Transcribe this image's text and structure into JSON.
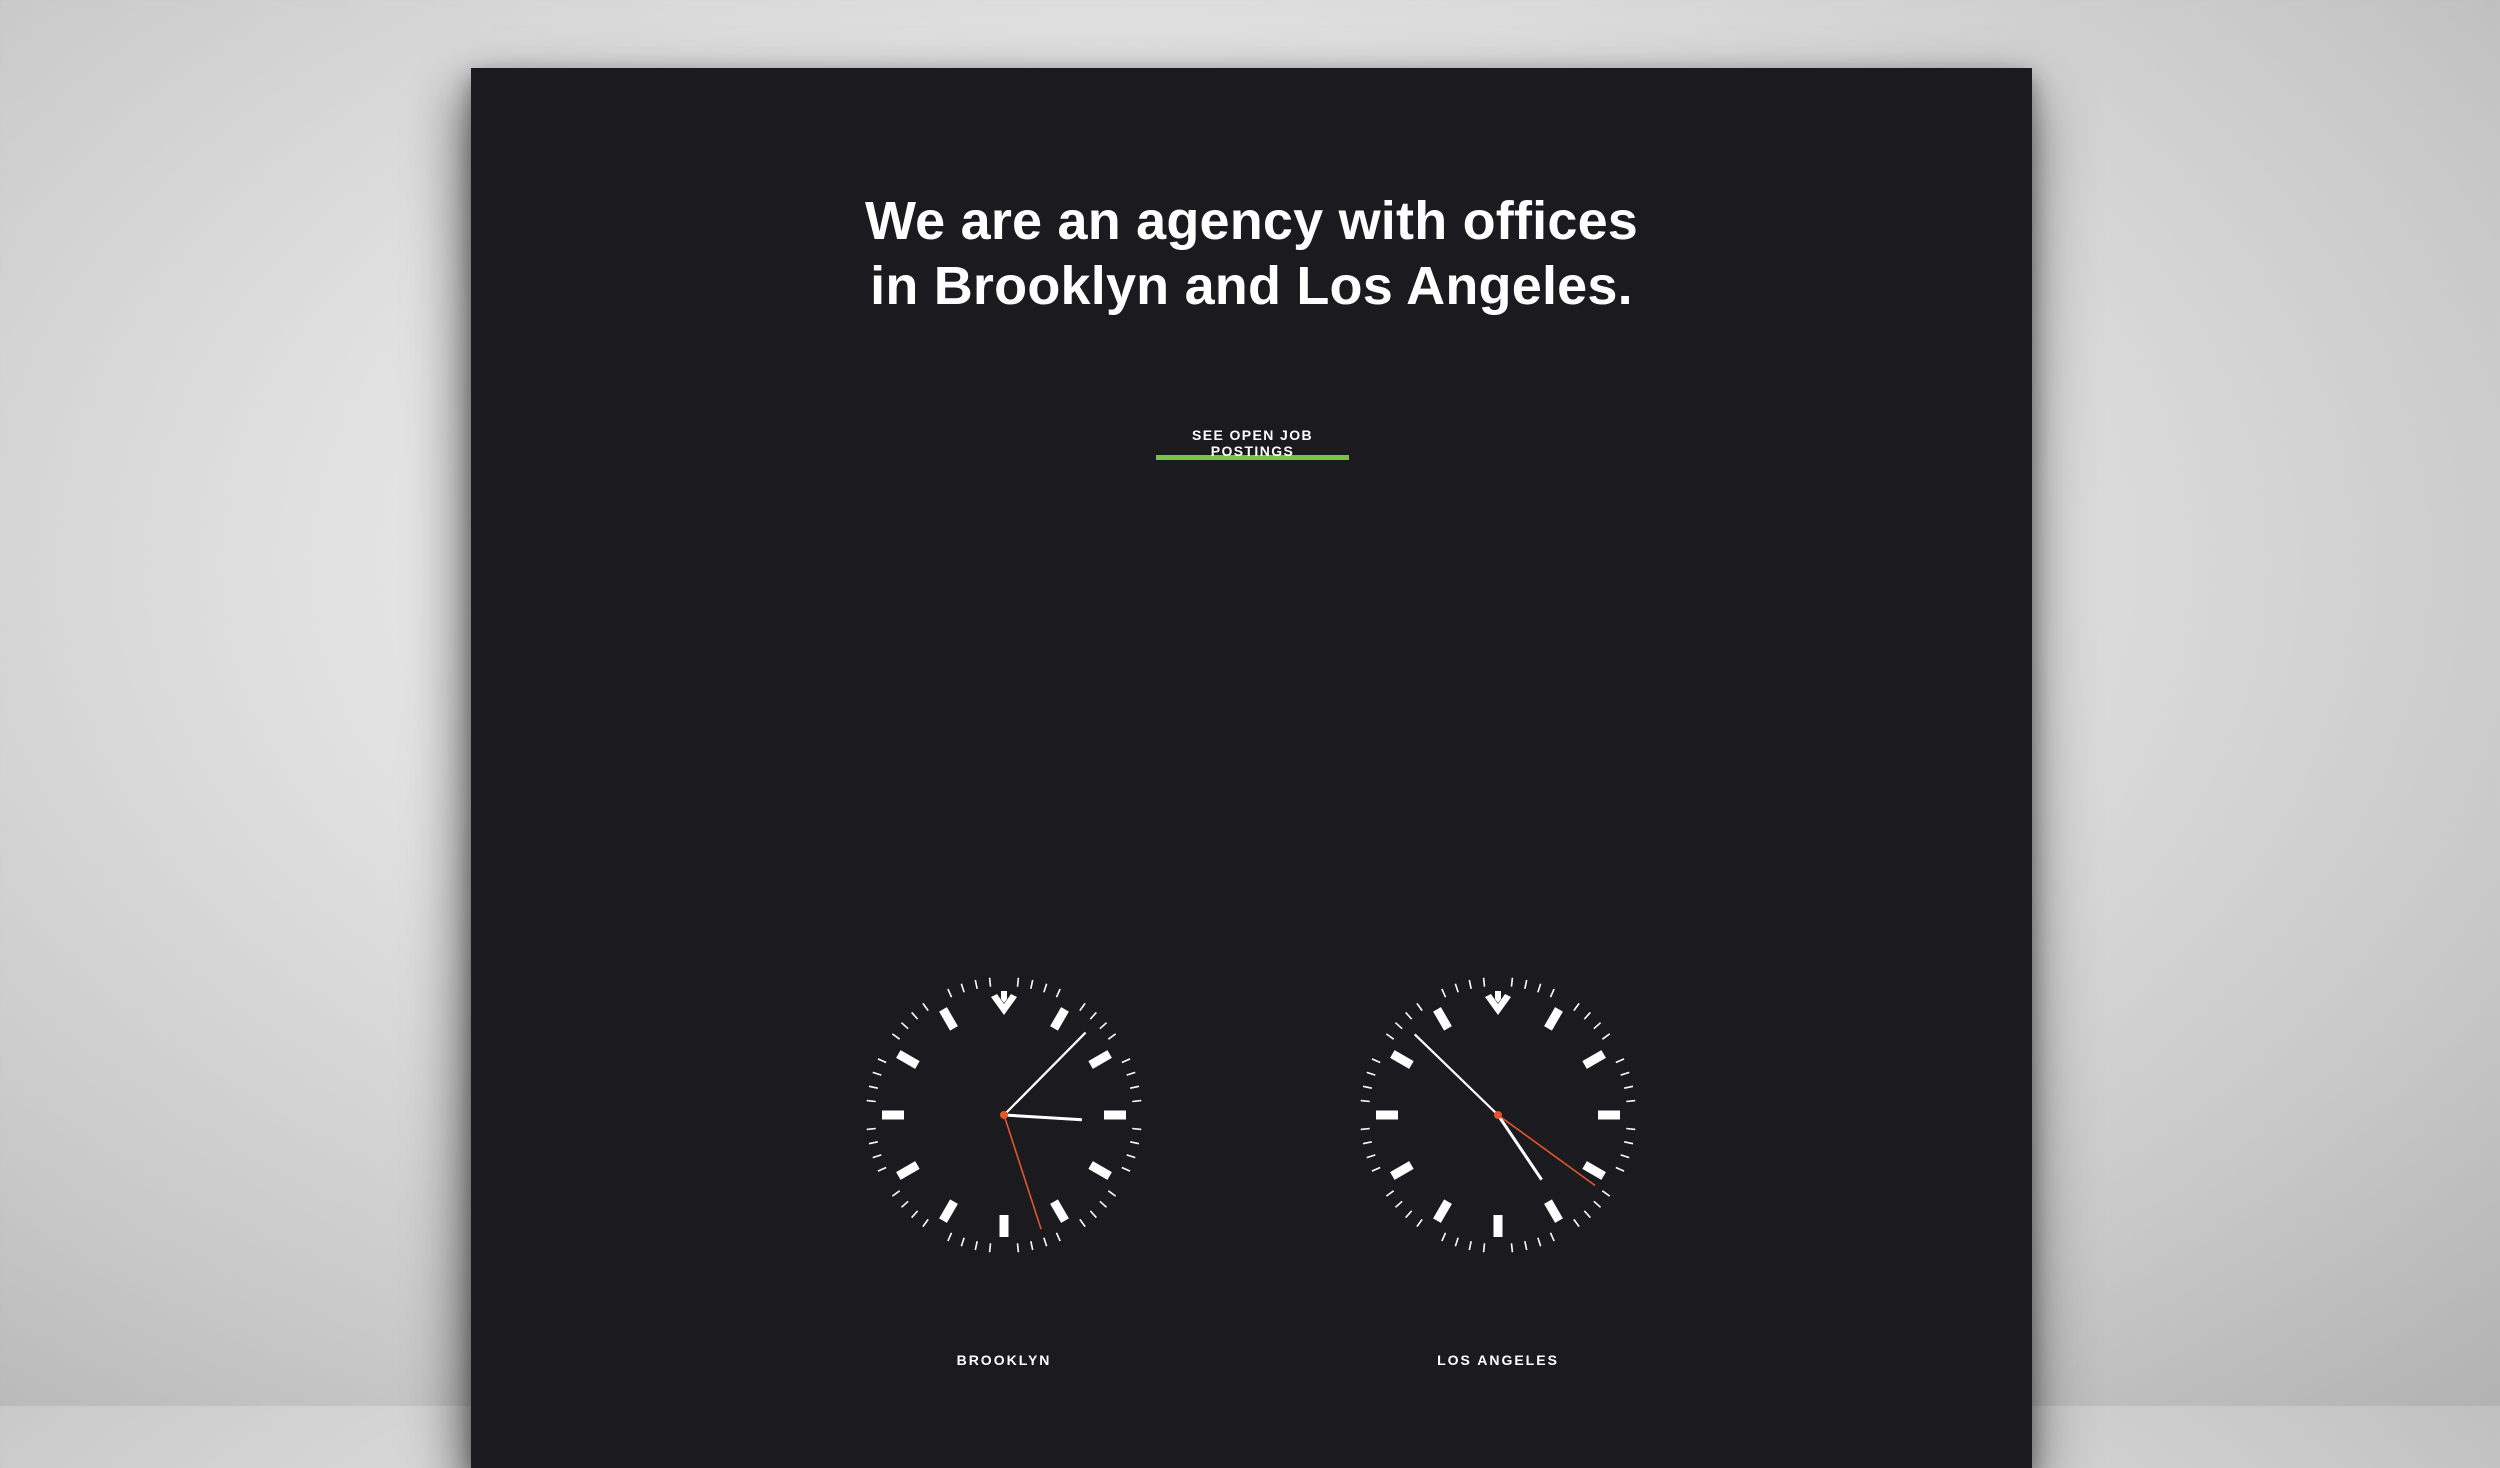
{
  "headline": {
    "line1": "We are an agency with offices",
    "line2": "in Brooklyn and Los Angeles."
  },
  "cta": {
    "label": "SEE OPEN JOB POSTINGS"
  },
  "clocks": [
    {
      "city": "BROOKLYN",
      "time": {
        "hour": 3,
        "minute": 7,
        "second": 27
      }
    },
    {
      "city": "LOS ANGELES",
      "time": {
        "hour": 4,
        "minute": 52,
        "second": 21
      }
    }
  ],
  "colors": {
    "background": "#1b1b1f",
    "accent": "#7ec142",
    "second_hand": "#e2552d",
    "text": "#ffffff"
  }
}
